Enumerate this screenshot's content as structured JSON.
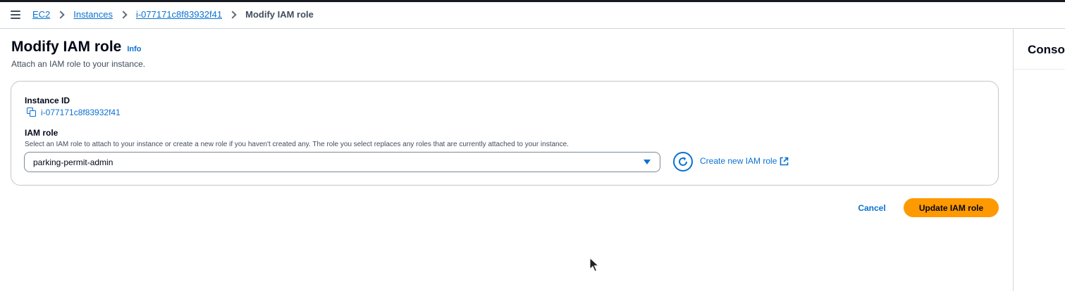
{
  "breadcrumb": {
    "items": [
      "EC2",
      "Instances",
      "i-077171c8f83932f41"
    ],
    "current": "Modify IAM role"
  },
  "page": {
    "title": "Modify IAM role",
    "info_label": "Info",
    "description": "Attach an IAM role to your instance."
  },
  "form": {
    "instance_id_label": "Instance ID",
    "instance_id_value": "i-077171c8f83932f41",
    "iam_role_label": "IAM role",
    "iam_role_description": "Select an IAM role to attach to your instance or create a new role if you haven't created any. The role you select replaces any roles that are currently attached to your instance.",
    "iam_role_selected": "parking-permit-admin",
    "create_role_link": "Create new IAM role"
  },
  "actions": {
    "cancel_label": "Cancel",
    "update_label": "Update IAM role"
  },
  "right_panel": {
    "title": "Console"
  },
  "colors": {
    "link": "#0972d3",
    "primary_button": "#ff9900",
    "text": "#000716"
  },
  "icons": [
    "menu-icon",
    "chevron-right-icon",
    "copy-icon",
    "caret-down-icon",
    "refresh-icon",
    "external-link-icon",
    "mouse-cursor-icon"
  ]
}
